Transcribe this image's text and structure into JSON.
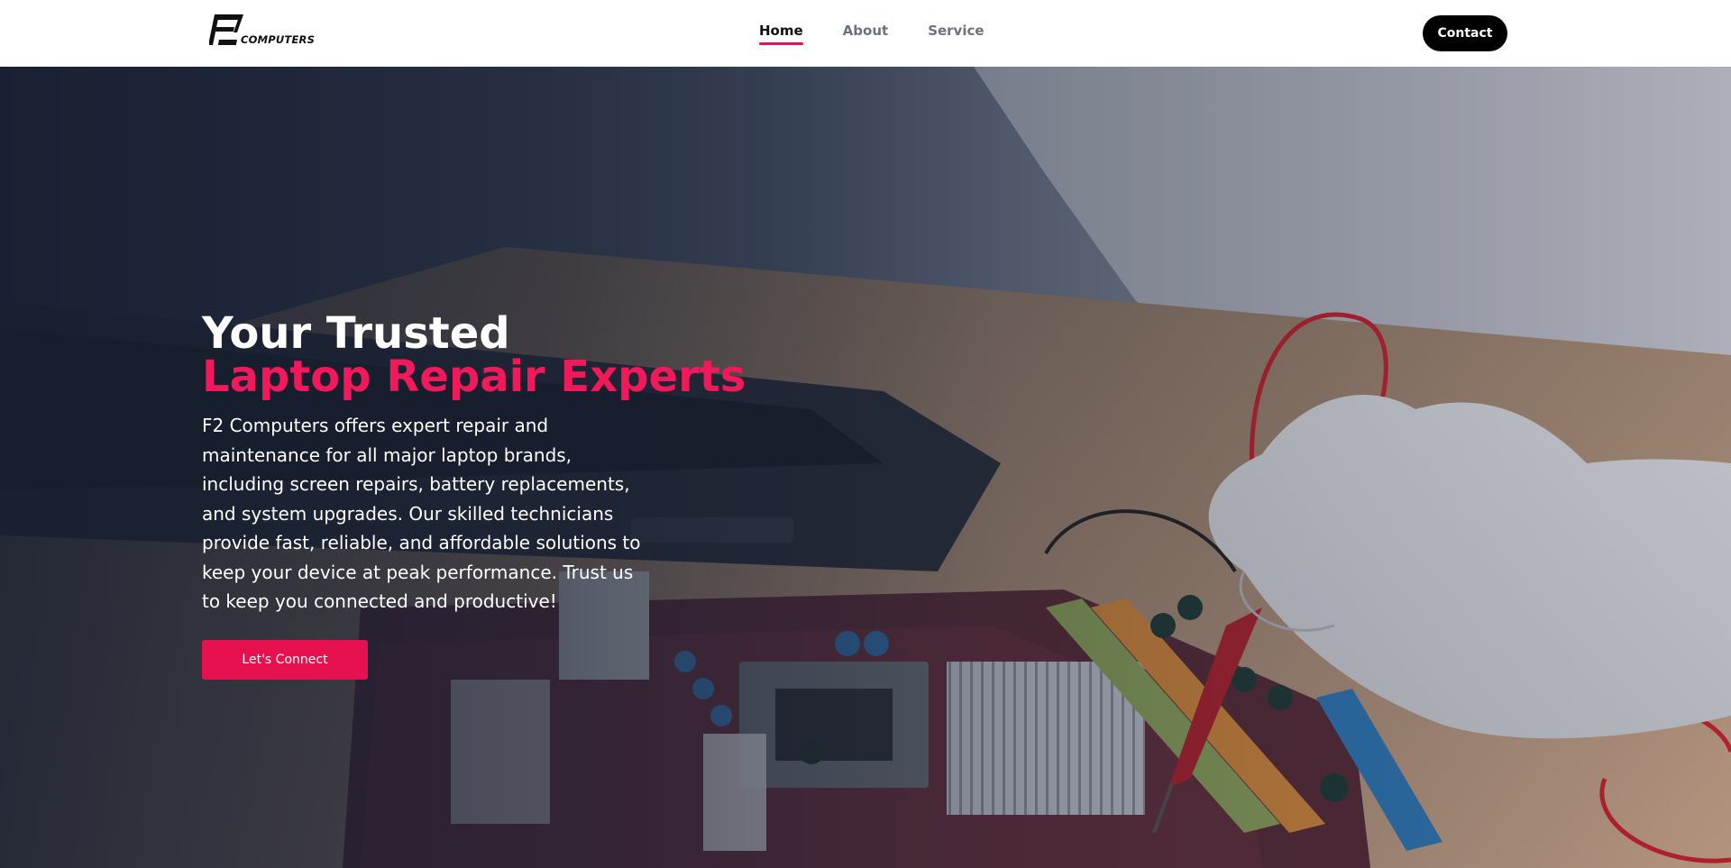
{
  "brand": {
    "logo_mark": "F2",
    "logo_text": "COMPUTERS"
  },
  "nav": {
    "items": [
      {
        "label": "Home",
        "active": true
      },
      {
        "label": "About",
        "active": false
      },
      {
        "label": "Service",
        "active": false
      }
    ],
    "contact_label": "Contact"
  },
  "hero": {
    "title_line1": "Your Trusted",
    "title_line2": "Laptop Repair Experts",
    "description": "F2 Computers offers expert repair and maintenance for all major laptop brands, including screen repairs, battery replacements, and system upgrades. Our skilled technicians provide fast, reliable, and affordable solutions to keep your device at peak performance. Trust us to keep you connected and productive!",
    "cta_label": "Let's Connect"
  },
  "colors": {
    "accent": "#e8114f",
    "header_bg": "#ffffff",
    "contact_bg": "#000000",
    "overlay": "#161e30"
  }
}
